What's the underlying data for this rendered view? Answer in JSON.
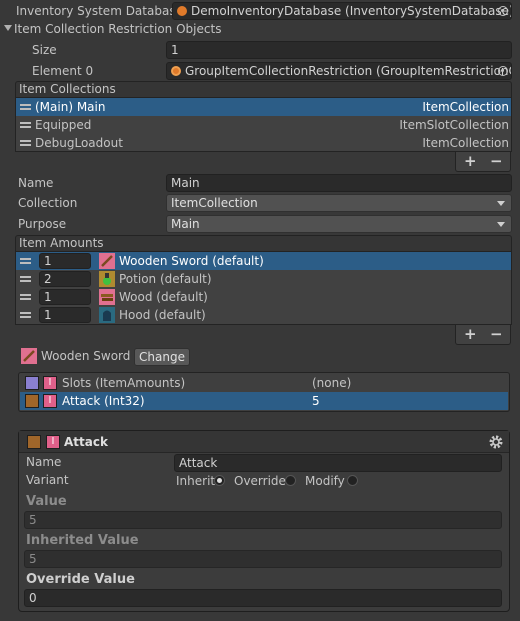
{
  "inventory_database": {
    "label": "Inventory System Database",
    "value": "DemoInventoryDatabase (InventorySystemDatabase)"
  },
  "restriction_objects": {
    "foldout_label": "Item Collection Restriction Objects",
    "size_label": "Size",
    "size_value": "1",
    "element_label": "Element 0",
    "element_value": "GroupItemCollectionRestriction (GroupItemRestrictionC"
  },
  "item_collections": {
    "header": "Item Collections",
    "rows": [
      {
        "name": "(Main) Main",
        "type": "ItemCollection"
      },
      {
        "name": "Equipped",
        "type": "ItemSlotCollection"
      },
      {
        "name": "DebugLoadout",
        "type": "ItemCollection"
      }
    ]
  },
  "collection_props": {
    "name_label": "Name",
    "name_value": "Main",
    "collection_label": "Collection",
    "collection_value": "ItemCollection",
    "purpose_label": "Purpose",
    "purpose_value": "Main"
  },
  "item_amounts": {
    "header": "Item Amounts",
    "rows": [
      {
        "amount": "1",
        "item": "Wooden Sword (default)",
        "icon": "sword-icon"
      },
      {
        "amount": "2",
        "item": "Potion (default)",
        "icon": "potion-icon"
      },
      {
        "amount": "1",
        "item": "Wood (default)",
        "icon": "wood-icon"
      },
      {
        "amount": "1",
        "item": "Hood (default)",
        "icon": "hood-icon"
      }
    ]
  },
  "list_controls": {
    "add": "+",
    "remove": "−"
  },
  "selected_item": {
    "name": "Wooden Sword",
    "change_button": "Change"
  },
  "attributes": {
    "rows": [
      {
        "name": "Slots (ItemAmounts)",
        "value": "(none)",
        "marker": "I"
      },
      {
        "name": "Attack (Int32)",
        "value": "5",
        "marker": "I"
      }
    ]
  },
  "attack_panel": {
    "title": "Attack",
    "marker": "I",
    "name_label": "Name",
    "name_value": "Attack",
    "variant_label": "Variant",
    "variant_options": [
      "Inherit",
      "Override",
      "Modify"
    ],
    "variant_selected": "Inherit",
    "value_title": "Value",
    "value": "5",
    "inherited_title": "Inherited Value",
    "inherited_value": "5",
    "override_title": "Override Value",
    "override_value": "0"
  },
  "colors": {
    "selection": "#2c5d87",
    "background": "#383838",
    "purple_square": "#8a7fd0",
    "brown_square": "#a0662a",
    "pink_marker": "#e0608a"
  }
}
